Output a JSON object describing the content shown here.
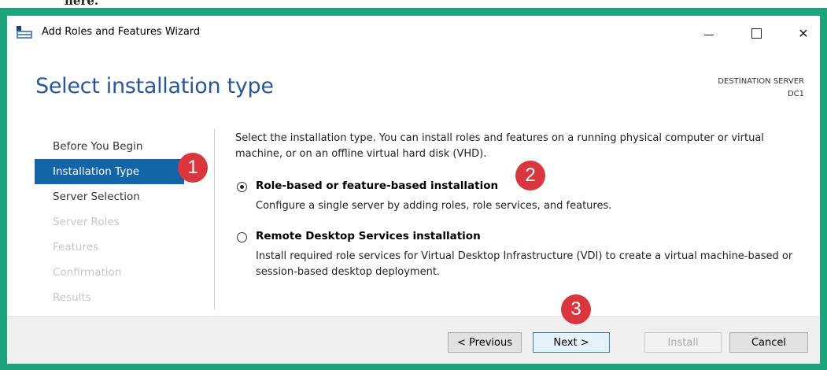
{
  "window": {
    "title": "Add Roles and Features Wizard",
    "controls": [
      "minimize-icon",
      "maximize-icon",
      "close-icon"
    ]
  },
  "header": {
    "page_title": "Select installation type",
    "destination_label": "DESTINATION SERVER",
    "destination_value": "DC1"
  },
  "nav": {
    "items": [
      {
        "label": "Before You Begin",
        "state": "normal"
      },
      {
        "label": "Installation Type",
        "state": "active"
      },
      {
        "label": "Server Selection",
        "state": "normal"
      },
      {
        "label": "Server Roles",
        "state": "disabled"
      },
      {
        "label": "Features",
        "state": "disabled"
      },
      {
        "label": "Confirmation",
        "state": "disabled"
      },
      {
        "label": "Results",
        "state": "disabled"
      }
    ]
  },
  "content": {
    "intro": "Select the installation type. You can install roles and features on a running physical computer or virtual machine, or on an offline virtual hard disk (VHD).",
    "options": [
      {
        "title": "Role-based or feature-based installation",
        "description": "Configure a single server by adding roles, role services, and features.",
        "selected": true
      },
      {
        "title": "Remote Desktop Services installation",
        "description": "Install required role services for Virtual Desktop Infrastructure (VDI) to create a virtual machine-based or session-based desktop deployment.",
        "selected": false
      }
    ]
  },
  "footer": {
    "previous": "< Previous",
    "next": "Next >",
    "install": "Install",
    "cancel": "Cancel"
  },
  "annotations": {
    "step1": "1",
    "step2": "2",
    "step3": "3"
  },
  "top_cut_text": "here.",
  "colors": {
    "frame": "#1fa37f",
    "title_blue": "#2b579a",
    "nav_active": "#1464a8",
    "badge_red": "#d9363e"
  }
}
